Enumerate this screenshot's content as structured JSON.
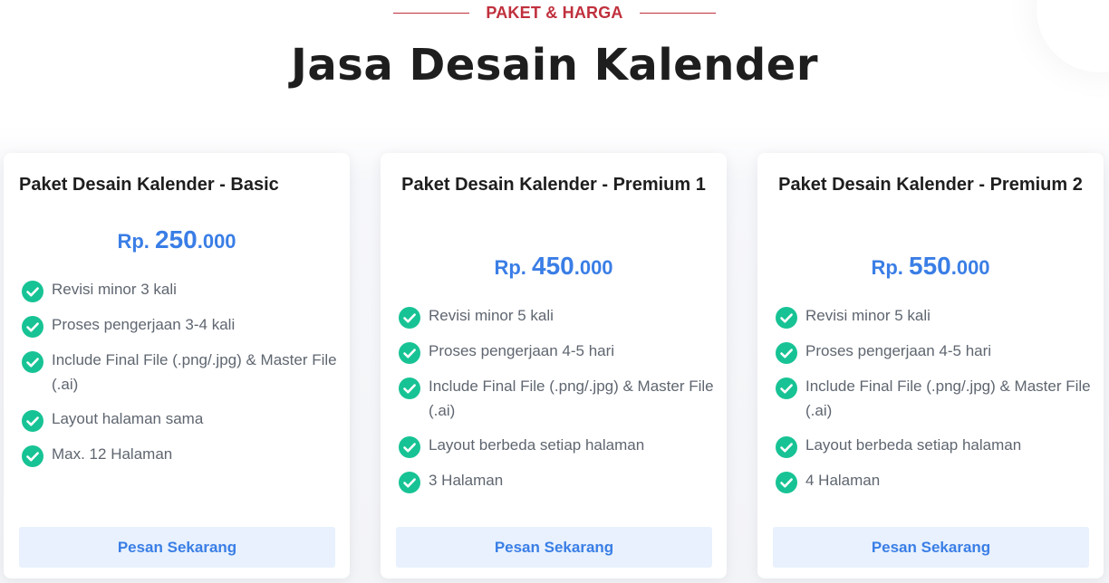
{
  "section": {
    "eyebrow": "PAKET & HARGA",
    "title": "Jasa Desain Kalender"
  },
  "colors": {
    "accent_red": "#c0303d",
    "price_blue": "#3a7ee6",
    "check_green": "#17c394",
    "button_bg": "#e8f1fd"
  },
  "cards": [
    {
      "title": "Paket Desain Kalender - Basic",
      "price_prefix": "Rp. ",
      "price_main": "250",
      "price_suffix": ".000",
      "features": [
        "Revisi minor 3 kali",
        "Proses pengerjaan 3-4 kali",
        "Include Final File (.png/.jpg) & Master File (.ai)",
        "Layout halaman sama",
        "Max. 12 Halaman"
      ],
      "button": "Pesan Sekarang",
      "check_icon": "check-circle-icon"
    },
    {
      "title": "Paket Desain Kalender - Premium 1",
      "price_prefix": "Rp. ",
      "price_main": "450",
      "price_suffix": ".000",
      "features": [
        "Revisi minor 5 kali",
        "Proses pengerjaan 4-5 hari",
        "Include Final File (.png/.jpg) & Master File (.ai)",
        "Layout berbeda setiap halaman",
        "3 Halaman"
      ],
      "button": "Pesan Sekarang",
      "check_icon": "check-circle-icon"
    },
    {
      "title": "Paket Desain Kalender - Premium 2",
      "price_prefix": "Rp. ",
      "price_main": "550",
      "price_suffix": ".000",
      "features": [
        "Revisi minor 5 kali",
        "Proses pengerjaan 4-5 hari",
        "Include Final File (.png/.jpg) & Master File (.ai)",
        "Layout berbeda setiap halaman",
        "4 Halaman"
      ],
      "button": "Pesan Sekarang",
      "check_icon": "check-circle-icon"
    }
  ]
}
